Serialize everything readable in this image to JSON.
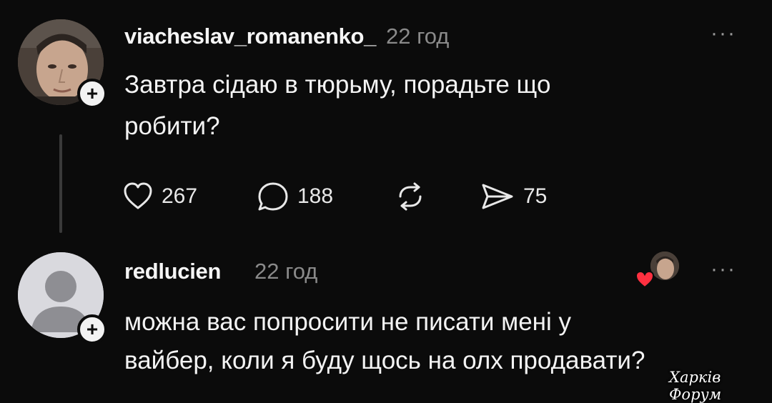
{
  "post": {
    "username": "viacheslav_romanenko_",
    "timestamp": "22 год",
    "more": "···",
    "text_line1": "Завтра сідаю в тюрьму, порадьте що",
    "text_line2": "робити?",
    "actions": {
      "likes": "267",
      "comments": "188",
      "shares": "75"
    }
  },
  "reply": {
    "username": "redlucien",
    "timestamp": "22 год",
    "more": "···",
    "text_line1": "можна вас попросити не писати мені у",
    "text_line2": "вайбер, коли я буду щось на олх продавати?"
  },
  "watermark": "Харків Форум",
  "icons": {
    "like": "heart-icon",
    "comment": "comment-icon",
    "repost": "repost-icon",
    "share": "send-icon",
    "plus": "plus-icon",
    "liked_by_author": "heart-badge-icon"
  },
  "colors": {
    "background": "#0b0b0b",
    "text": "#f3f3f3",
    "muted": "#8a8a8a",
    "heart": "#ff3040"
  }
}
